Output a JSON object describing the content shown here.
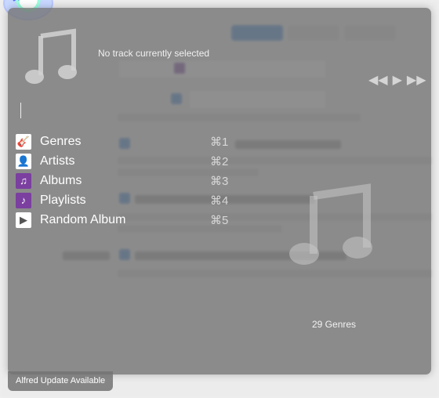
{
  "alfred": {
    "track_label": "No track currently selected",
    "count_label": "29 Genres",
    "update_badge": "Alfred Update Available",
    "menu": [
      {
        "label": "Genres",
        "shortcut": "⌘1",
        "icon": "guitar-icon"
      },
      {
        "label": "Artists",
        "shortcut": "⌘2",
        "icon": "artist-icon"
      },
      {
        "label": "Albums",
        "shortcut": "⌘3",
        "icon": "album-icon"
      },
      {
        "label": "Playlists",
        "shortcut": "⌘4",
        "icon": "playlist-icon"
      },
      {
        "label": "Random Album",
        "shortcut": "⌘5",
        "icon": "random-play-icon"
      }
    ],
    "colors": {
      "overlay": "#737373",
      "accent": "#7b3fa0",
      "blue": "#3b82d6"
    }
  }
}
